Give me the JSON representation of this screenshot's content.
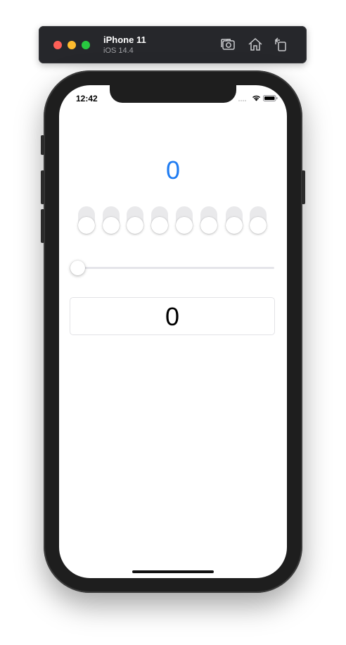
{
  "simulator": {
    "device_name": "iPhone 11",
    "os_version": "iOS 14.4",
    "buttons": [
      "screenshot-button",
      "home-button",
      "rotate-button"
    ]
  },
  "status_bar": {
    "time": "12:42"
  },
  "app": {
    "counter_value": "0",
    "switches": [
      {
        "on": false
      },
      {
        "on": false
      },
      {
        "on": false
      },
      {
        "on": false
      },
      {
        "on": false
      },
      {
        "on": false
      },
      {
        "on": false
      },
      {
        "on": false
      }
    ],
    "slider_value": 0,
    "text_field_value": "0"
  },
  "colors": {
    "accent": "#1f7cf2",
    "switch_off": "#e9e9eb",
    "close": "#fe5f57",
    "minimize": "#febc2e",
    "zoom": "#28c840"
  }
}
